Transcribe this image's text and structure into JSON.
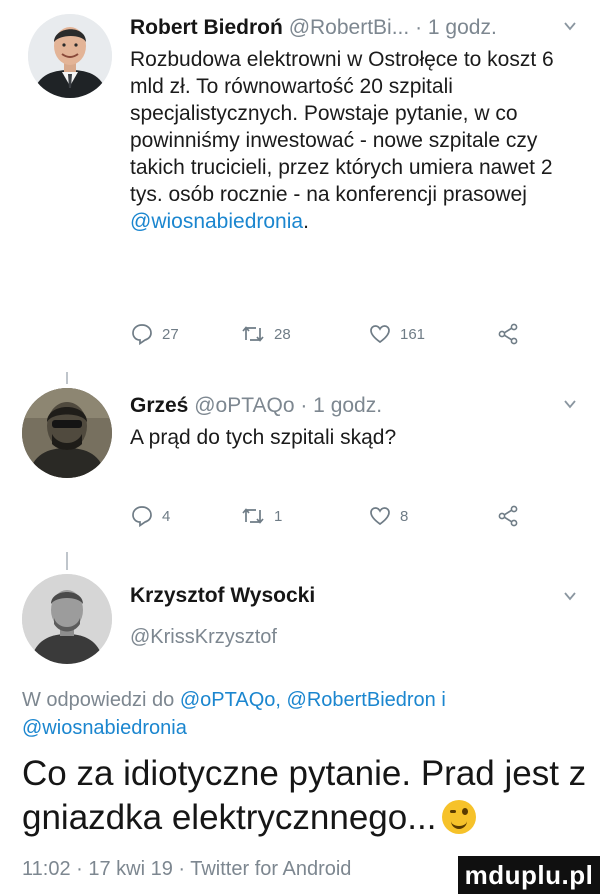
{
  "tweet1": {
    "name": "Robert Biedroń",
    "handle": "@RobertBi...",
    "time": "· 1 godz.",
    "text": "Rozbudowa elektrowni w Ostrołęce to koszt 6 mld zł. To równowartość 20 szpitali specjalistycznych. Powstaje pytanie, w co powinniśmy inwestować - nowe szpitale czy takich trucicieli, przez których umiera nawet 2 tys. osób rocznie - na konferencji prasowej",
    "mention": "@wiosnabiedronia",
    "tail": ".",
    "replies": "27",
    "retweets": "28",
    "likes": "161"
  },
  "tweet2": {
    "name": "Grześ",
    "handle": "@oPTAQo",
    "time": "· 1 godz.",
    "text": "A prąd do tych szpitali skąd?",
    "replies": "4",
    "retweets": "1",
    "likes": "8"
  },
  "tweet3": {
    "name": "Krzysztof Wysocki",
    "handle": "@KrissKrzysztof",
    "reply_prefix": "W odpowiedzi do",
    "reply_mention_1": "@oPTAQo,",
    "reply_mention_2": "@RobertBiedron i",
    "reply_mention_3": "@wiosnabiedronia",
    "text": "Co za idiotyczne pytanie. Prad jest z gniazdka elektrycznnego...",
    "footer": "11:02 · 17 kwi 19 · Twitter for Android"
  },
  "watermark": "mduplu.pl",
  "colors": {
    "mention": "#1b86cf",
    "meta": "#7d8790",
    "text": "#1b1b1b"
  },
  "icons": [
    "reply-icon",
    "retweet-icon",
    "like-icon",
    "share-icon",
    "chevron-down-icon",
    "wink-emoji-icon"
  ]
}
